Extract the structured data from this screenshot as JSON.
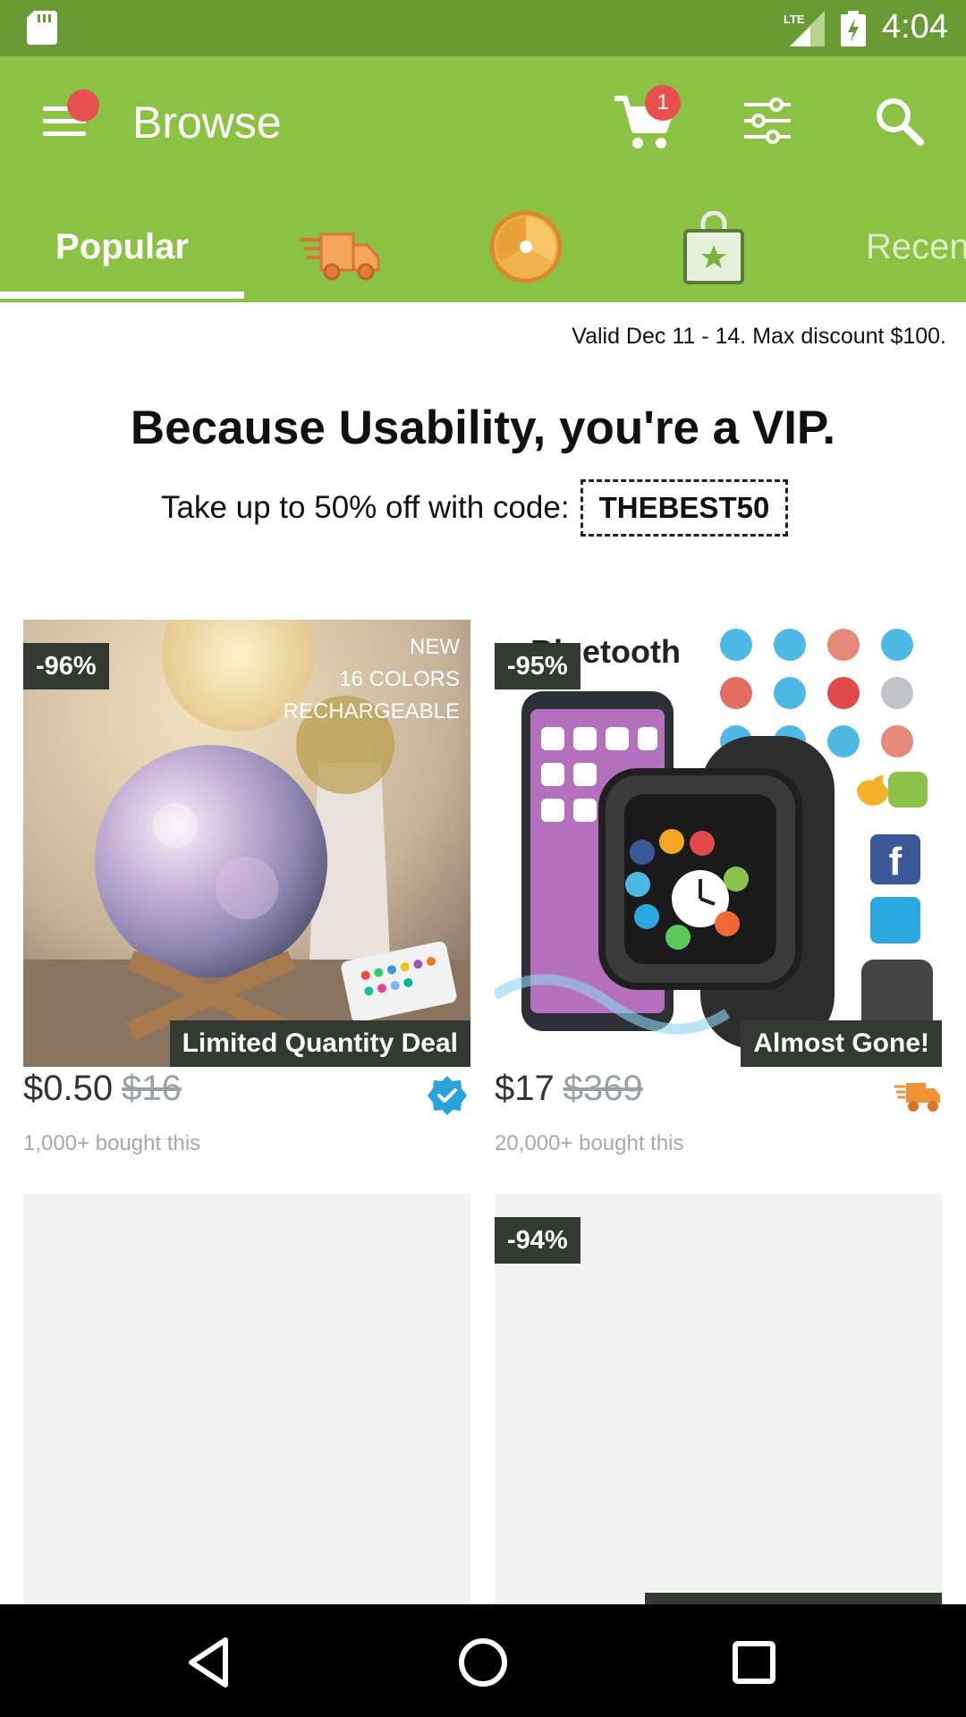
{
  "status_bar": {
    "time": "4:04",
    "network": "LTE",
    "sd_icon": "sd-card-icon",
    "battery_icon": "battery-charging-icon"
  },
  "app_bar": {
    "title": "Browse",
    "cart_count": "1",
    "accent": "#8bc243",
    "badge_color": "#e8504f"
  },
  "tabs": [
    {
      "label": "Popular",
      "active": true
    },
    {
      "icon": "delivery-truck-icon"
    },
    {
      "icon": "prize-wheel-icon"
    },
    {
      "icon": "shopping-bag-icon"
    },
    {
      "label": "Recen"
    }
  ],
  "promo": {
    "valid": "Valid Dec 11 - 14. Max discount $100.",
    "headline": "Because Usability, you're a VIP.",
    "offer": "Take up to 50% off with code:",
    "code": "THEBEST50"
  },
  "products": [
    {
      "discount": "-96%",
      "image_text": [
        "NEW",
        "16 COLORS",
        "RECHARGEABLE"
      ],
      "label": "Limited Quantity Deal",
      "price": "$0.50",
      "old_price": "$16",
      "bought": "1,000+ bought this",
      "badge_icon": "verified-check-icon"
    },
    {
      "discount": "-95%",
      "image_text": [
        "Bluetooth"
      ],
      "label": "Almost Gone!",
      "price": "$17",
      "old_price": "$369",
      "bought": "20,000+ bought this",
      "badge_icon": "fast-shipping-truck-icon"
    },
    {
      "discount": ""
    },
    {
      "discount": "-94%"
    }
  ]
}
